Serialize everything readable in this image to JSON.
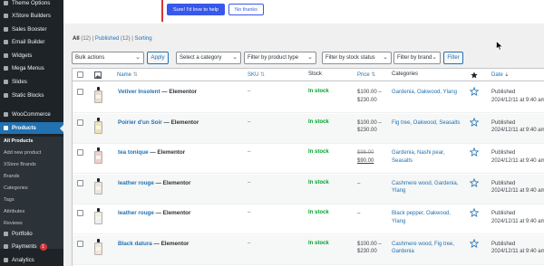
{
  "sidebar": {
    "items": [
      {
        "label": "Theme Options",
        "icon": "theme-icon"
      },
      {
        "label": "XStore Builders",
        "icon": "builder-icon"
      },
      {
        "label": "Sales Booster",
        "icon": "booster-icon"
      },
      {
        "label": "Email Builder",
        "icon": "email-icon"
      },
      {
        "label": "Widgets",
        "icon": "widgets-icon"
      },
      {
        "label": "Mega Menus",
        "icon": "menu-icon"
      },
      {
        "label": "Slides",
        "icon": "slides-icon"
      },
      {
        "label": "Static Blocks",
        "icon": "blocks-icon"
      },
      {
        "label": "WooCommerce",
        "icon": "woocommerce-icon"
      },
      {
        "label": "Products",
        "icon": "products-icon"
      },
      {
        "label": "Portfolio",
        "icon": "portfolio-icon"
      },
      {
        "label": "Payments",
        "icon": "payments-icon",
        "badge": "1"
      },
      {
        "label": "Analytics",
        "icon": "analytics-icon"
      }
    ],
    "submenu": [
      "All Products",
      "Add new product",
      "XStore Brands",
      "Brands",
      "Categories",
      "Tags",
      "Attributes",
      "Reviews"
    ]
  },
  "notice": {
    "primary_button": "Sure! I'd love to help",
    "secondary_button": "No thanks"
  },
  "views": {
    "all": "All",
    "all_count": "(12)",
    "published": "Published",
    "published_count": "(12)",
    "sorting": "Sorting"
  },
  "tablenav": {
    "bulk_actions": "Bulk actions",
    "apply": "Apply",
    "filter_category": "Select a category",
    "filter_type": "Filter by product type",
    "filter_stock": "Filter by stock status",
    "filter_brand": "Filter by brand",
    "filter_button": "Filter"
  },
  "table": {
    "headers": {
      "name": "Name",
      "sku": "SKU",
      "stock": "Stock",
      "price": "Price",
      "categories": "Categories",
      "date": "Date"
    },
    "rows": [
      {
        "name": "Vetiver Insolent",
        "suffix": "— Elementor",
        "sku": "–",
        "stock": "In stock",
        "price_line1": "$100.00 –",
        "price_line2": "$230.00",
        "sale": false,
        "categories": "Gardenia, Oakwood, Ylang",
        "status": "Published",
        "date": "2024/12/11 at 9:40 am",
        "bottle_color": "#e4ddd0"
      },
      {
        "name": "Poirier d'un Soir",
        "suffix": "— Elementor",
        "sku": "–",
        "stock": "In stock",
        "price_line1": "$100.00 –",
        "price_line2": "$230.00",
        "sale": false,
        "categories": "Fig tree, Oakwood, Seasalts",
        "status": "Published",
        "date": "2024/12/11 at 9:40 am",
        "bottle_color": "#efe1b8"
      },
      {
        "name": "tea tonique",
        "suffix": "— Elementor",
        "sku": "–",
        "stock": "In stock",
        "price_line1": "$98.00",
        "price_line2": "$90.00",
        "sale": true,
        "categories": "Gardenia, Nashi pear, Seasalts",
        "status": "Published",
        "date": "2024/12/11 at 9:40 am",
        "bottle_color": "#eccfcf"
      },
      {
        "name": "leather rouge",
        "suffix": "— Elementor",
        "sku": "–",
        "stock": "In stock",
        "price_line1": "–",
        "price_line2": "",
        "sale": false,
        "categories": "Cashmere wood, Gardenia, Ylang",
        "status": "Published",
        "date": "2024/12/11 at 9:40 am",
        "bottle_color": "#e8e6e1"
      },
      {
        "name": "leather rouge",
        "suffix": "— Elementor",
        "sku": "–",
        "stock": "In stock",
        "price_line1": "–",
        "price_line2": "",
        "sale": false,
        "categories": "Black pepper, Oakwood, Ylang",
        "status": "Published",
        "date": "2024/12/11 at 9:40 am",
        "bottle_color": "#eeeeec"
      },
      {
        "name": "Black datura",
        "suffix": "— Elementor",
        "sku": "–",
        "stock": "In stock",
        "price_line1": "$100.00 –",
        "price_line2": "$230.00",
        "sale": false,
        "categories": "Cashmere wood, Fig tree, Gardenia",
        "status": "Published",
        "date": "2024/12/11 at 9:40 am",
        "bottle_color": "#ece7dd"
      }
    ]
  },
  "colors": {
    "accent": "#2271b1",
    "sidebar": "#1d2327",
    "in_stock": "#00a32a",
    "notice_button": "#3858e9"
  }
}
